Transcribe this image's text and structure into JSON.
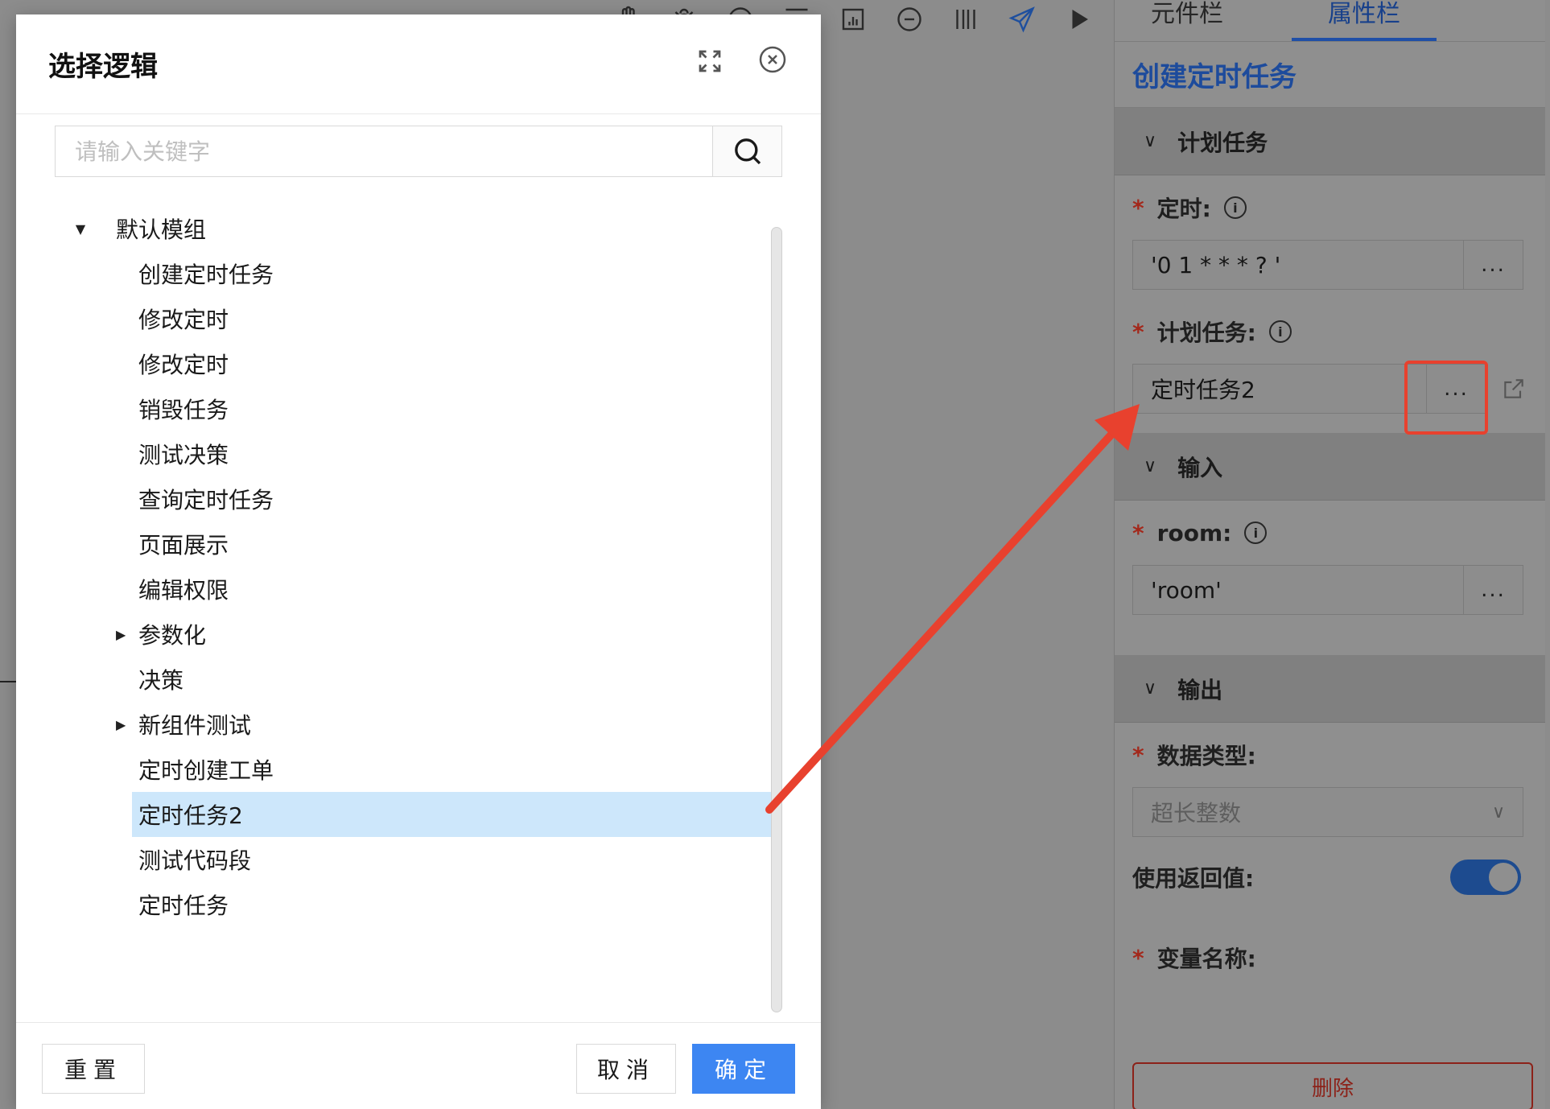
{
  "toolbar": {
    "icons": [
      "hand-icon",
      "bug-icon",
      "zoom-in-icon",
      "align-icon",
      "layout-icon",
      "zoom-out-icon",
      "distribute-icon",
      "send-icon",
      "play-icon"
    ]
  },
  "panel": {
    "tabs": [
      "元件栏",
      "属性栏"
    ],
    "active_tab": "属性栏",
    "title": "创建定时任务",
    "sections": {
      "plan": {
        "header": "计划任务"
      },
      "input": {
        "header": "输入"
      },
      "output": {
        "header": "输出"
      }
    },
    "fields": {
      "timer_label": "定时:",
      "timer_value": "'0 1 * * * ? '",
      "task_label": "计划任务:",
      "task_value": "定时任务2",
      "room_label": "room:",
      "room_value": "'room'",
      "datatype_label": "数据类型:",
      "datatype_value": "超长整数",
      "use_return_label": "使用返回值:",
      "var_name_label": "变量名称:"
    },
    "dots": "...",
    "use_return_on": true,
    "delete_label": "删除"
  },
  "modal": {
    "title": "选择逻辑",
    "search_placeholder": "请输入关键字",
    "tree": {
      "root": "默认模组",
      "items": [
        {
          "label": "创建定时任务",
          "expandable": false,
          "selected": false
        },
        {
          "label": "修改定时",
          "expandable": false,
          "selected": false
        },
        {
          "label": "修改定时",
          "expandable": false,
          "selected": false
        },
        {
          "label": "销毁任务",
          "expandable": false,
          "selected": false
        },
        {
          "label": "测试决策",
          "expandable": false,
          "selected": false
        },
        {
          "label": "查询定时任务",
          "expandable": false,
          "selected": false
        },
        {
          "label": "页面展示",
          "expandable": false,
          "selected": false
        },
        {
          "label": "编辑权限",
          "expandable": false,
          "selected": false
        },
        {
          "label": "参数化",
          "expandable": true,
          "selected": false
        },
        {
          "label": "决策",
          "expandable": false,
          "selected": false
        },
        {
          "label": "新组件测试",
          "expandable": true,
          "selected": false
        },
        {
          "label": "定时创建工单",
          "expandable": false,
          "selected": false
        },
        {
          "label": "定时任务2",
          "expandable": false,
          "selected": true
        },
        {
          "label": "测试代码段",
          "expandable": false,
          "selected": false
        },
        {
          "label": "定时任务",
          "expandable": false,
          "selected": false
        }
      ]
    },
    "buttons": {
      "reset": "重置",
      "cancel": "取消",
      "ok": "确定"
    }
  },
  "colors": {
    "primary": "#3d86f2",
    "selected_row": "#cde7fb",
    "annotation": "#e8412e",
    "required": "#a3281b"
  }
}
